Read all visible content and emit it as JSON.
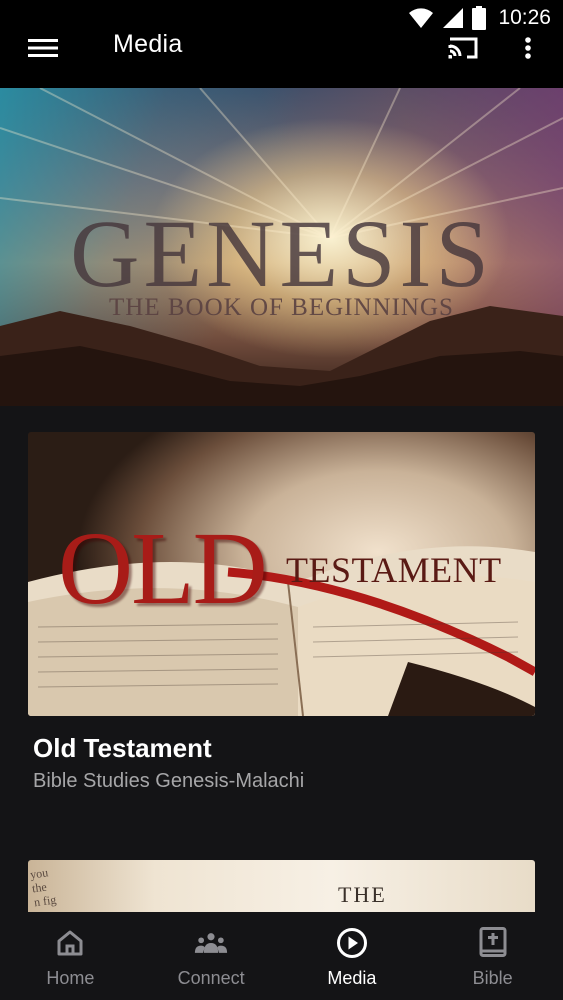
{
  "status_bar": {
    "time": "10:26"
  },
  "app_bar": {
    "title": "Media"
  },
  "hero": {
    "title": "GENESIS",
    "subtitle": "THE BOOK OF BEGINNINGS"
  },
  "media_item": {
    "image_text_primary": "OLD",
    "image_text_secondary": "TESTAMENT",
    "title": "Old Testament",
    "subtitle": "Bible Studies Genesis-Malachi"
  },
  "next_item": {
    "image_text": "THE",
    "margin_text": "you\nthe\nn fig"
  },
  "bottom_nav": {
    "items": [
      {
        "label": "Home",
        "icon": "home-icon",
        "active": false
      },
      {
        "label": "Connect",
        "icon": "people-icon",
        "active": false
      },
      {
        "label": "Media",
        "icon": "play-circle-icon",
        "active": true
      },
      {
        "label": "Bible",
        "icon": "bible-icon",
        "active": false
      }
    ]
  },
  "colors": {
    "background": "#141416",
    "bar": "#000000",
    "nav_inactive": "#8d8d92",
    "nav_active": "#ffffff"
  }
}
